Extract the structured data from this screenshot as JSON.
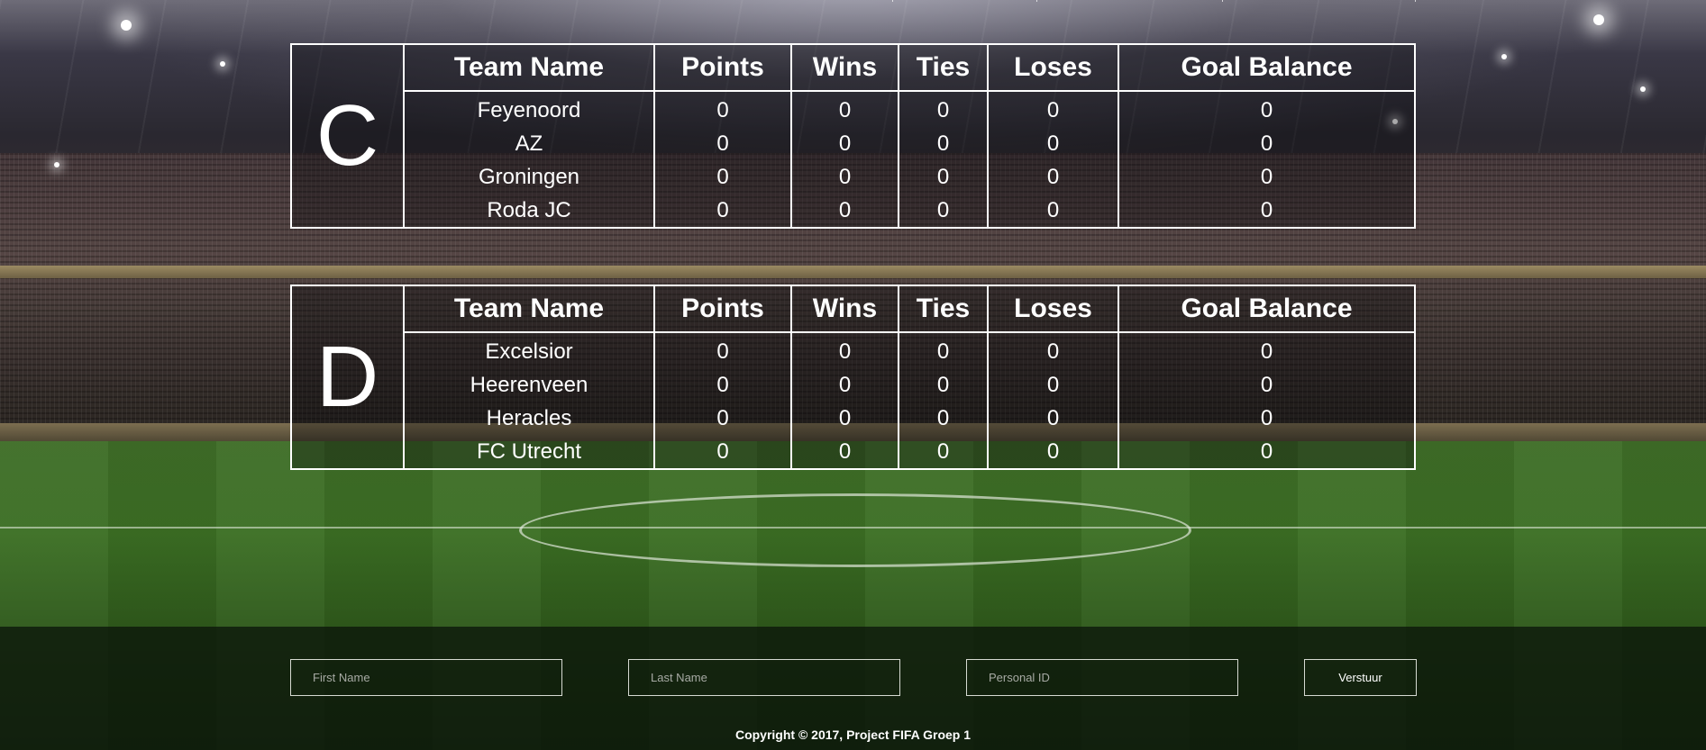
{
  "columns": {
    "team": "Team Name",
    "points": "Points",
    "wins": "Wins",
    "ties": "Ties",
    "loses": "Loses",
    "goal_balance": "Goal Balance"
  },
  "groups": [
    {
      "letter": "C",
      "teams": [
        {
          "name": "Feyenoord",
          "points": "0",
          "wins": "0",
          "ties": "0",
          "loses": "0",
          "goal_balance": "0"
        },
        {
          "name": "AZ",
          "points": "0",
          "wins": "0",
          "ties": "0",
          "loses": "0",
          "goal_balance": "0"
        },
        {
          "name": "Groningen",
          "points": "0",
          "wins": "0",
          "ties": "0",
          "loses": "0",
          "goal_balance": "0"
        },
        {
          "name": "Roda JC",
          "points": "0",
          "wins": "0",
          "ties": "0",
          "loses": "0",
          "goal_balance": "0"
        }
      ]
    },
    {
      "letter": "D",
      "teams": [
        {
          "name": "Excelsior",
          "points": "0",
          "wins": "0",
          "ties": "0",
          "loses": "0",
          "goal_balance": "0"
        },
        {
          "name": "Heerenveen",
          "points": "0",
          "wins": "0",
          "ties": "0",
          "loses": "0",
          "goal_balance": "0"
        },
        {
          "name": "Heracles",
          "points": "0",
          "wins": "0",
          "ties": "0",
          "loses": "0",
          "goal_balance": "0"
        },
        {
          "name": "FC Utrecht",
          "points": "0",
          "wins": "0",
          "ties": "0",
          "loses": "0",
          "goal_balance": "0"
        }
      ]
    }
  ],
  "form": {
    "first_name_placeholder": "First Name",
    "last_name_placeholder": "Last Name",
    "personal_id_placeholder": "Personal ID",
    "submit_label": "Verstuur"
  },
  "footer": {
    "copyright": "Copyright © 2017, Project FIFA Groep 1"
  }
}
